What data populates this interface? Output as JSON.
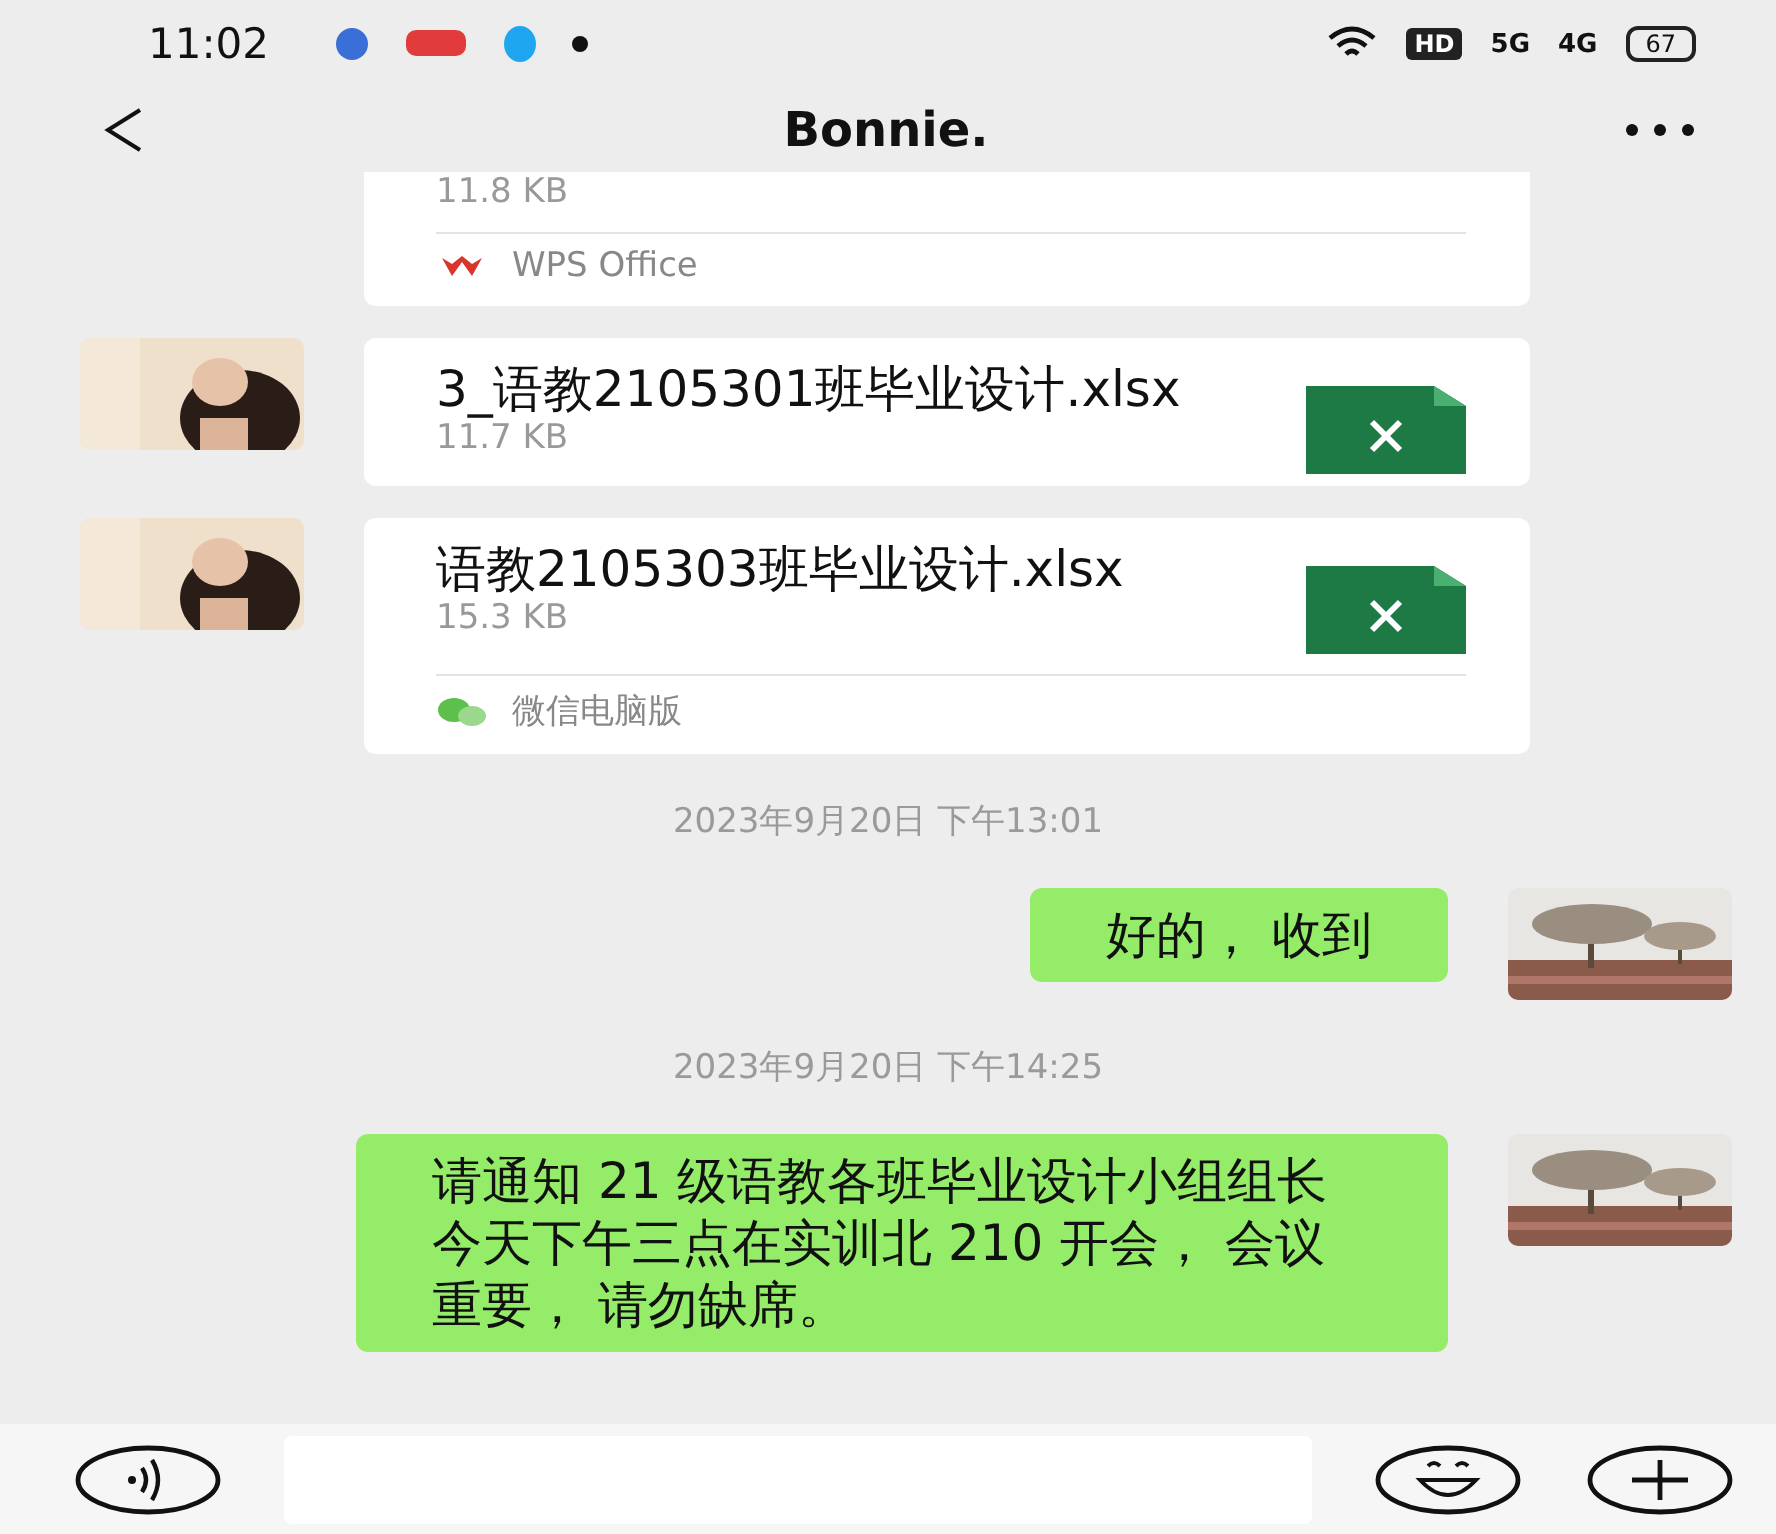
{
  "status_bar": {
    "time": "11:02",
    "network": [
      "HD",
      "5G",
      "4G"
    ],
    "battery": "67"
  },
  "header": {
    "title": "Bonnie."
  },
  "messages": [
    {
      "kind": "file",
      "outgoing": false,
      "clipped": true,
      "size": "11.8 KB",
      "source": {
        "kind": "wps",
        "label": "WPS Office"
      }
    },
    {
      "kind": "file",
      "outgoing": false,
      "name": "3_语教2105301班毕业设计.xlsx",
      "size": "11.7 KB"
    },
    {
      "kind": "file",
      "outgoing": false,
      "name": "语教2105303班毕业设计.xlsx",
      "size": "15.3 KB",
      "source": {
        "kind": "wechat",
        "label": "微信电脑版"
      }
    },
    {
      "kind": "time",
      "text": "2023年9月20日 下午13:01"
    },
    {
      "kind": "text",
      "outgoing": true,
      "text": "好的， 收到"
    },
    {
      "kind": "time",
      "text": "2023年9月20日 下午14:25"
    },
    {
      "kind": "text",
      "outgoing": true,
      "text": "请通知 21 级语教各班毕业设计小组组长今天下午三点在实训北 210 开会， 会议重要， 请勿缺席。"
    }
  ]
}
